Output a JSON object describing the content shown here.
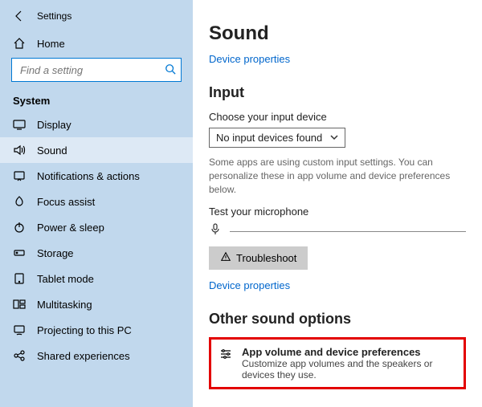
{
  "titlebar": {
    "label": "Settings"
  },
  "sidebar": {
    "home": "Home",
    "search_placeholder": "Find a setting",
    "section": "System",
    "items": [
      {
        "label": "Display"
      },
      {
        "label": "Sound"
      },
      {
        "label": "Notifications & actions"
      },
      {
        "label": "Focus assist"
      },
      {
        "label": "Power & sleep"
      },
      {
        "label": "Storage"
      },
      {
        "label": "Tablet mode"
      },
      {
        "label": "Multitasking"
      },
      {
        "label": "Projecting to this PC"
      },
      {
        "label": "Shared experiences"
      }
    ]
  },
  "main": {
    "heading": "Sound",
    "device_props_link": "Device properties",
    "input_heading": "Input",
    "input_label": "Choose your input device",
    "input_select_value": "No input devices found",
    "input_hint": "Some apps are using custom input settings. You can personalize these in app volume and device preferences below.",
    "test_mic_label": "Test your microphone",
    "troubleshoot": "Troubleshoot",
    "device_props_link2": "Device properties",
    "other_heading": "Other sound options",
    "app_vol_title": "App volume and device preferences",
    "app_vol_sub": "Customize app volumes and the speakers or devices they use."
  }
}
